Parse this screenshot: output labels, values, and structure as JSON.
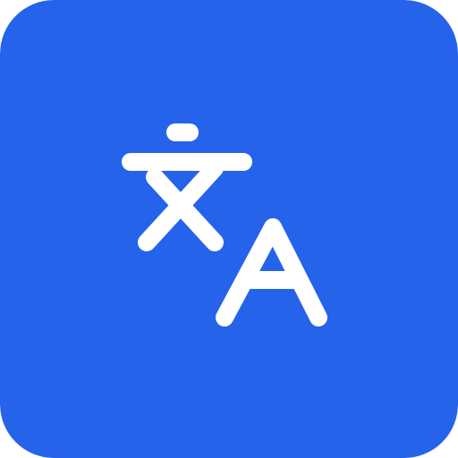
{
  "app_icon": {
    "icon": "translate-icon",
    "background_color": "#2563EB",
    "glyph_color": "#FFFFFF",
    "glyphs": [
      "文",
      "A"
    ]
  }
}
